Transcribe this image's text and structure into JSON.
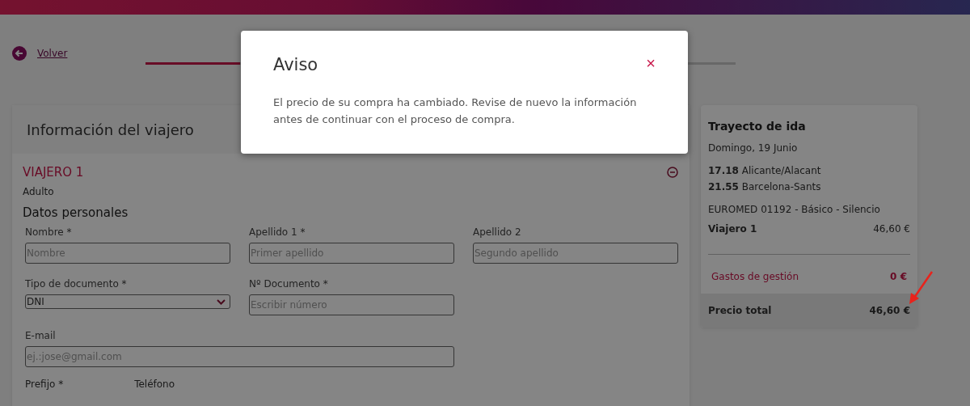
{
  "back_link": {
    "label": "Volver"
  },
  "progress": {
    "level": 0.16
  },
  "traveler_card": {
    "title": "Información del viajero",
    "traveler": {
      "heading": "VIAJERO 1",
      "type": "Adulto",
      "expanded": true
    },
    "section": "Datos personales",
    "fields": [
      {
        "kind": "input",
        "label": "Nombre *",
        "placeholder": "Nombre"
      },
      {
        "kind": "input",
        "label": "Apellido 1 *",
        "placeholder": "Primer apellido"
      },
      {
        "kind": "input",
        "label": "Apellido 2",
        "placeholder": "Segundo apellido"
      },
      {
        "kind": "select",
        "label": "Tipo de documento *",
        "value": "DNI"
      },
      {
        "kind": "input",
        "label": "Nº Documento *",
        "placeholder": "Escribir número"
      },
      {
        "kind": "wide",
        "label": "E-mail",
        "placeholder": "ej.:jose@gmail.com"
      }
    ],
    "bottom_labels": [
      "Prefijo *",
      "Teléfono"
    ]
  },
  "summary": {
    "title": "Trayecto de ida",
    "date": "Domingo, 19 Junio",
    "stops": [
      {
        "time": "17.18",
        "station": "Alicante/Alacant"
      },
      {
        "time": "21.55",
        "station": "Barcelona-Sants"
      }
    ],
    "train": "EUROMED 01192 - Básico - Silencio",
    "traveler_row": {
      "label": "Viajero 1",
      "price": "46,60 €"
    },
    "fees": {
      "label": "Gastos de gestión",
      "price": "0 €"
    },
    "total": {
      "label": "Precio total",
      "price": "46,60 €"
    }
  },
  "modal": {
    "title": "Aviso",
    "close": "×",
    "message": "El precio de su compra ha cambiado. Revise de nuevo la información antes de continuar con el proceso de compra."
  }
}
